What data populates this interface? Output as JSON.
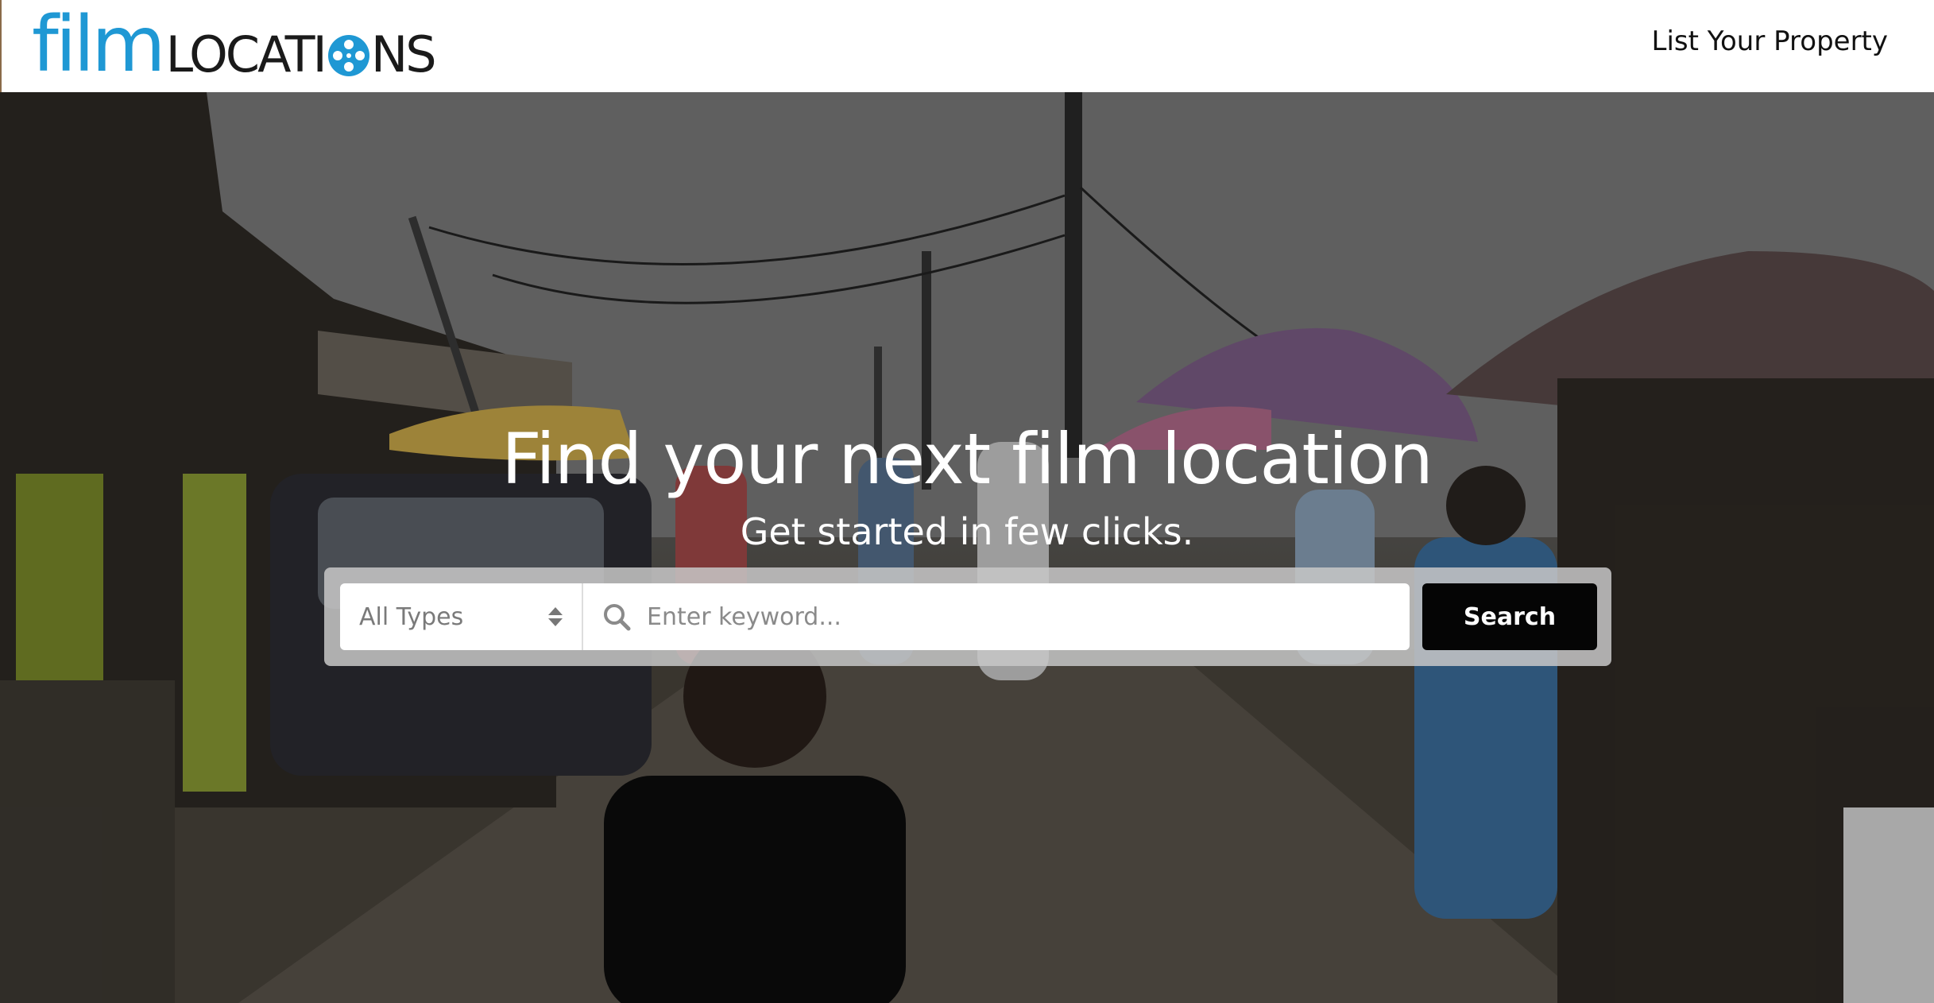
{
  "header": {
    "logo_part1": "film",
    "logo_part2": "LOCATI",
    "logo_part3": "NS",
    "nav_link": "List Your Property"
  },
  "hero": {
    "title": "Find your next film location",
    "subtitle": "Get started in few clicks."
  },
  "search": {
    "type_select": "All Types",
    "keyword_placeholder": "Enter keyword...",
    "button_label": "Search"
  },
  "colors": {
    "brand_blue": "#1f98d4",
    "button_bg": "#050505"
  }
}
